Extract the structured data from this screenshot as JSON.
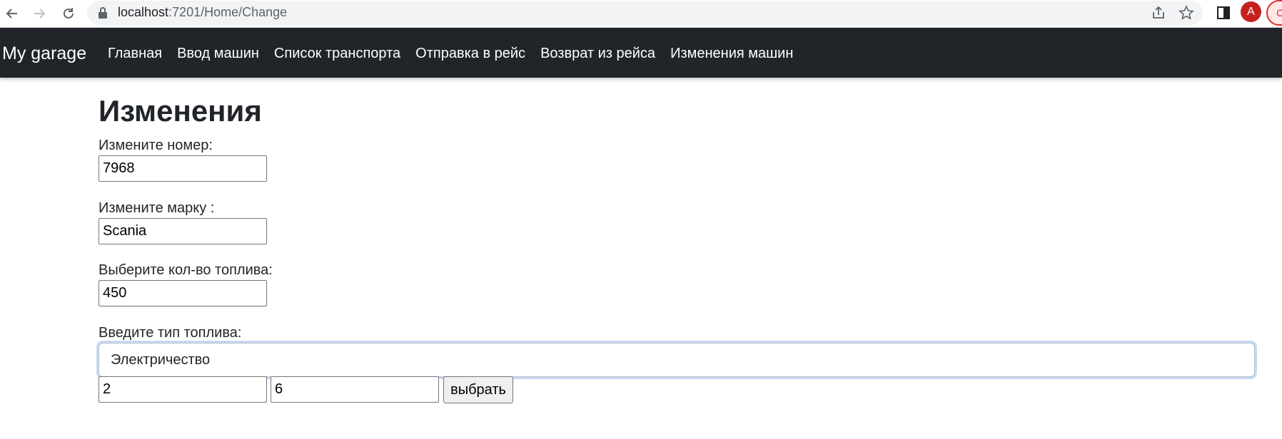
{
  "browser": {
    "url_host": "localhost",
    "url_rest": ":7201/Home/Change",
    "avatar_letter": "A",
    "ext_letter": "C",
    "icons": [
      "back-icon",
      "forward-icon",
      "reload-icon",
      "lock-icon",
      "share-icon",
      "star-icon",
      "side-panel-icon"
    ]
  },
  "navbar": {
    "brand": "My garage",
    "links": [
      "Главная",
      "Ввод машин",
      "Список транспорта",
      "Отправка в рейс",
      "Возврат из рейса",
      "Изменения машин"
    ],
    "background": "#212529"
  },
  "page": {
    "title": "Изменения",
    "number_label": "Измените номер:",
    "number_value": "7968",
    "brand_label": "Измените марку :",
    "brand_value": "Scania",
    "fuel_amount_label": "Выберите кол-во топлива:",
    "fuel_amount_value": "450",
    "fuel_type_label": "Введите тип топлива:",
    "fuel_type_value": "Электричество",
    "extra_input_1": "2",
    "extra_input_2": "6",
    "choose_button": "выбрать"
  }
}
